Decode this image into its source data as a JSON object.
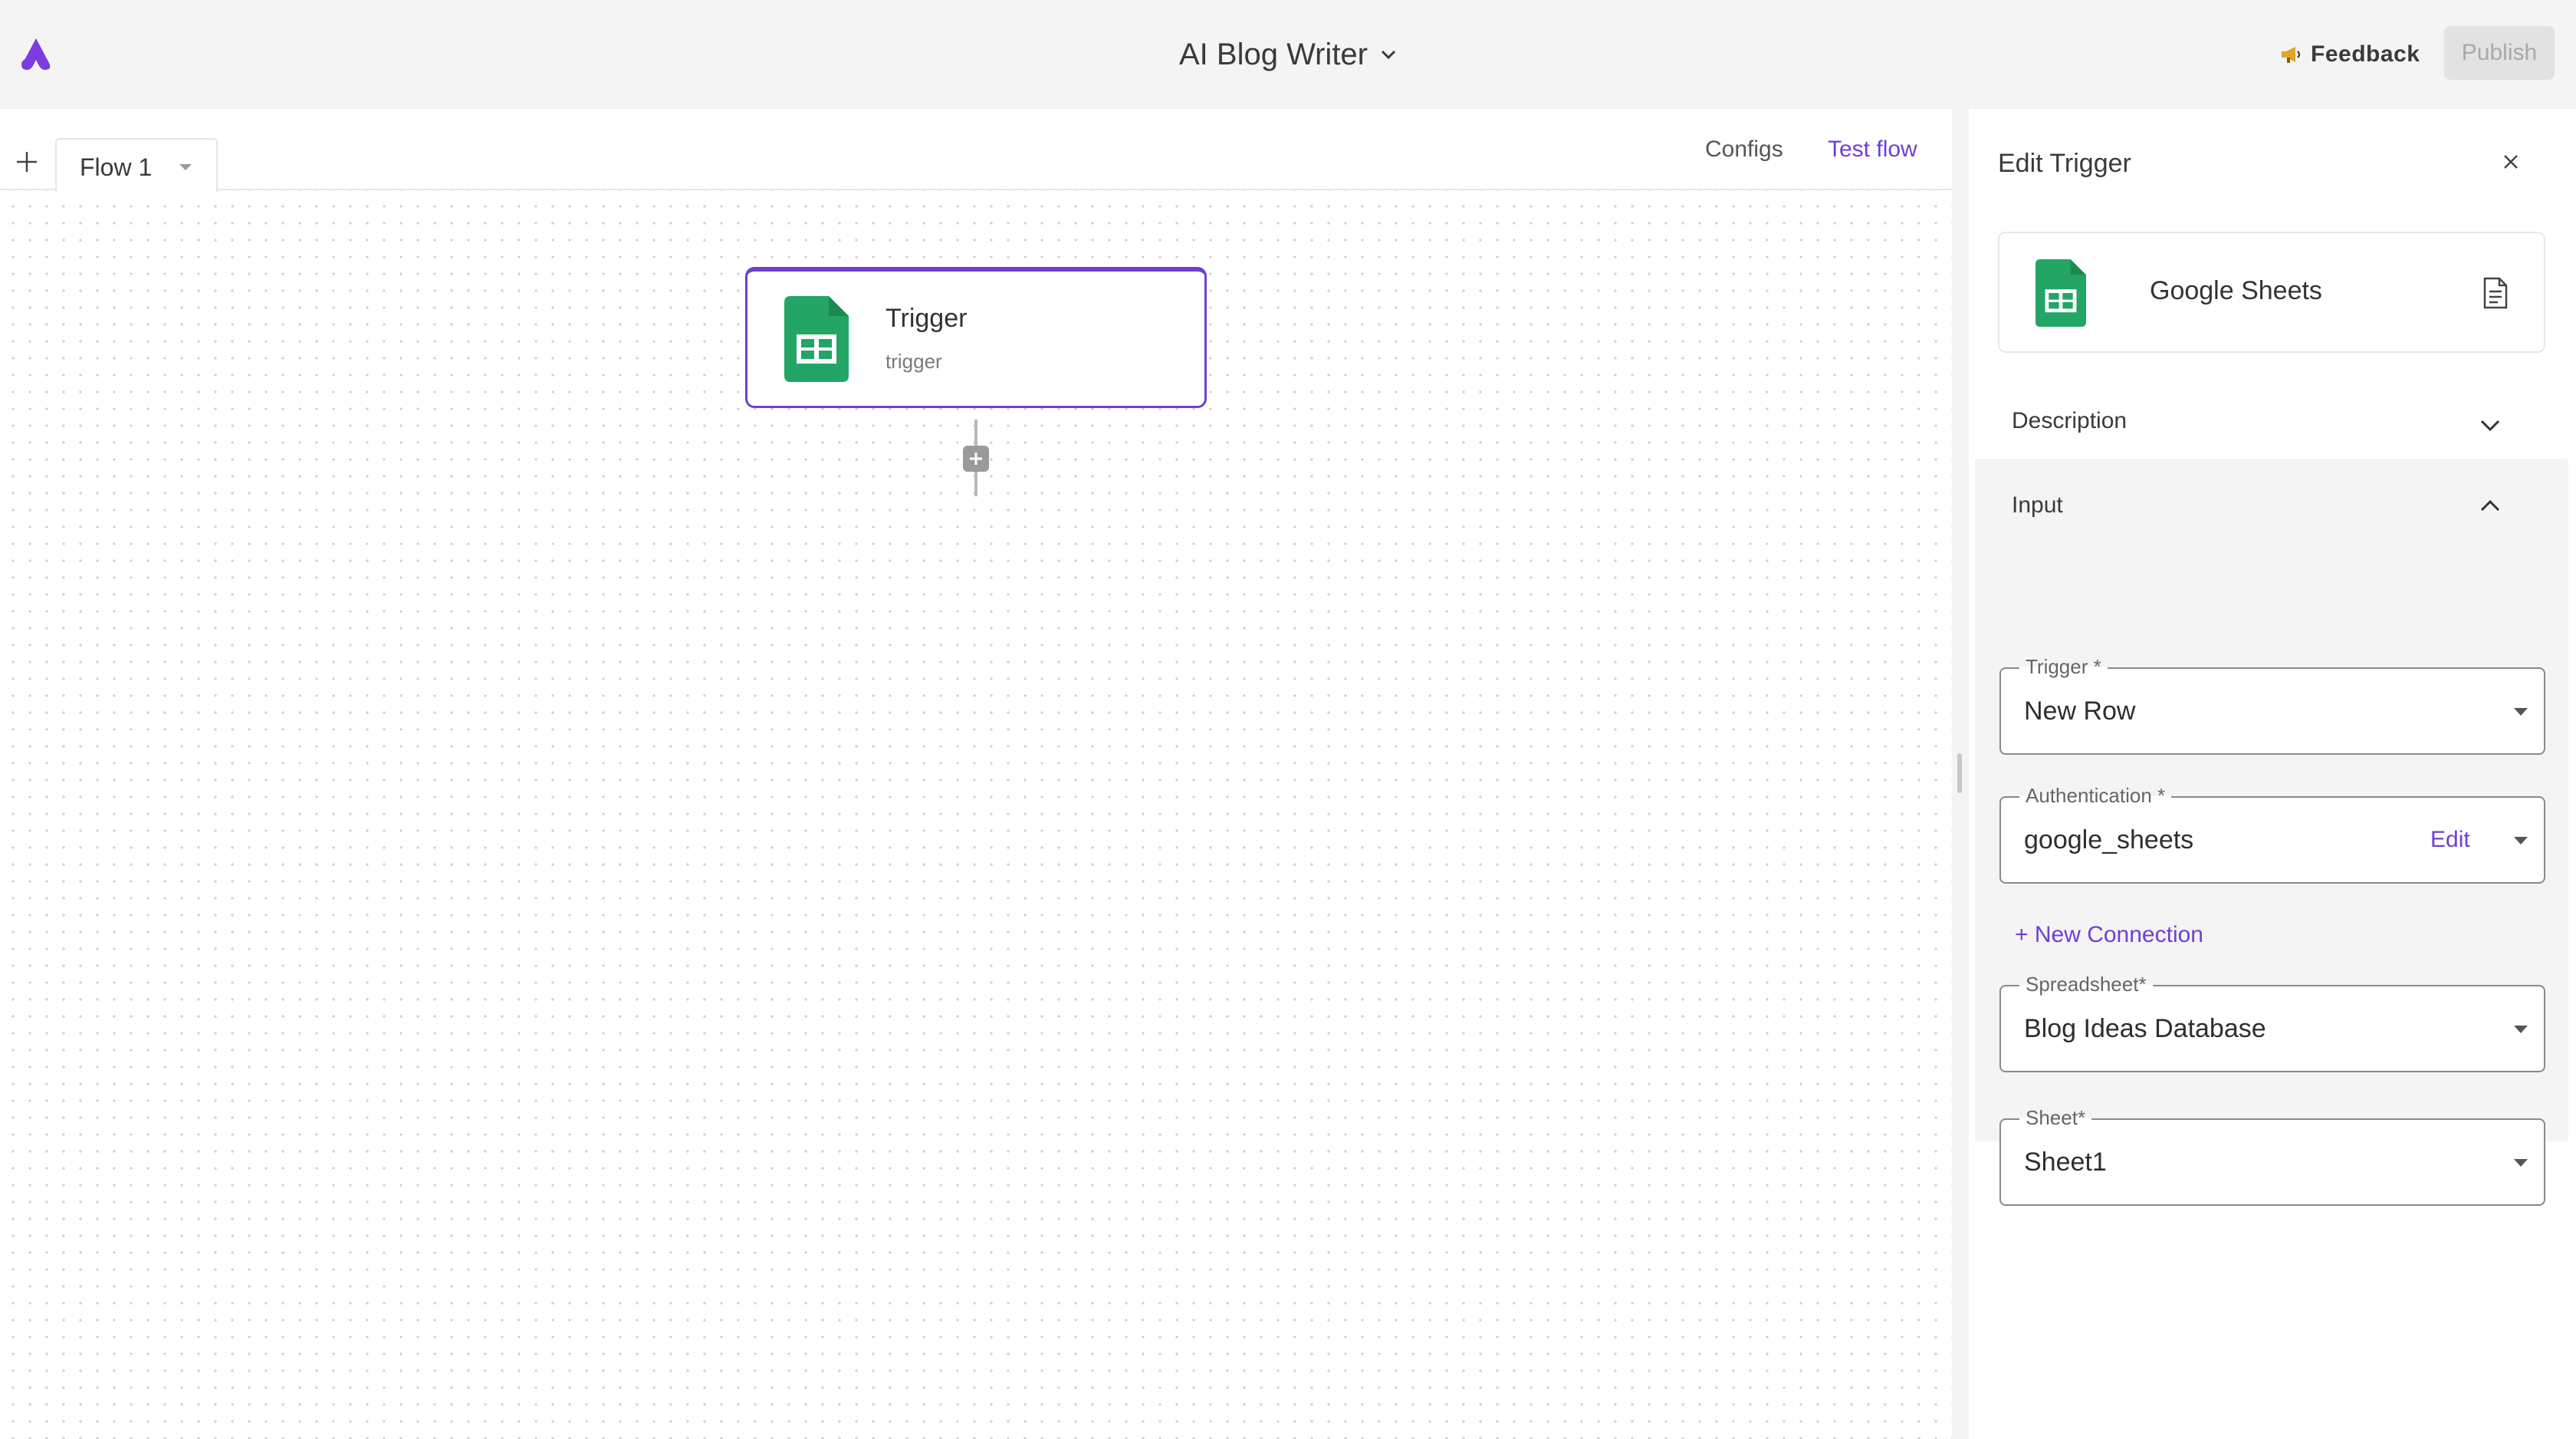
{
  "header": {
    "title": "AI Blog Writer",
    "feedback_label": "Feedback",
    "publish_label": "Publish"
  },
  "tabs": {
    "flow_tab_label": "Flow 1",
    "configs_label": "Configs",
    "test_flow_label": "Test flow"
  },
  "canvas": {
    "node": {
      "title": "Trigger",
      "subtitle": "trigger"
    }
  },
  "panel": {
    "title": "Edit Trigger",
    "piece_name": "Google Sheets",
    "description_label": "Description",
    "input_label": "Input",
    "fields": {
      "trigger": {
        "label": "Trigger *",
        "value": "New Row"
      },
      "authentication": {
        "label": "Authentication *",
        "value": "google_sheets",
        "edit_label": "Edit"
      },
      "new_connection_label": "+ New Connection",
      "spreadsheet": {
        "label": "Spreadsheet*",
        "value": "Blog Ideas Database"
      },
      "sheet": {
        "label": "Sheet*",
        "value": "Sheet1"
      }
    }
  },
  "colors": {
    "accent": "#6e3fd3",
    "sheets_green": "#23a566",
    "topbar_bg": "#f4f4f4"
  },
  "icons": {
    "logo": "app-logo-icon",
    "feedback": "megaphone-icon",
    "close": "close-icon",
    "document": "document-icon",
    "sheets": "google-sheets-icon"
  }
}
